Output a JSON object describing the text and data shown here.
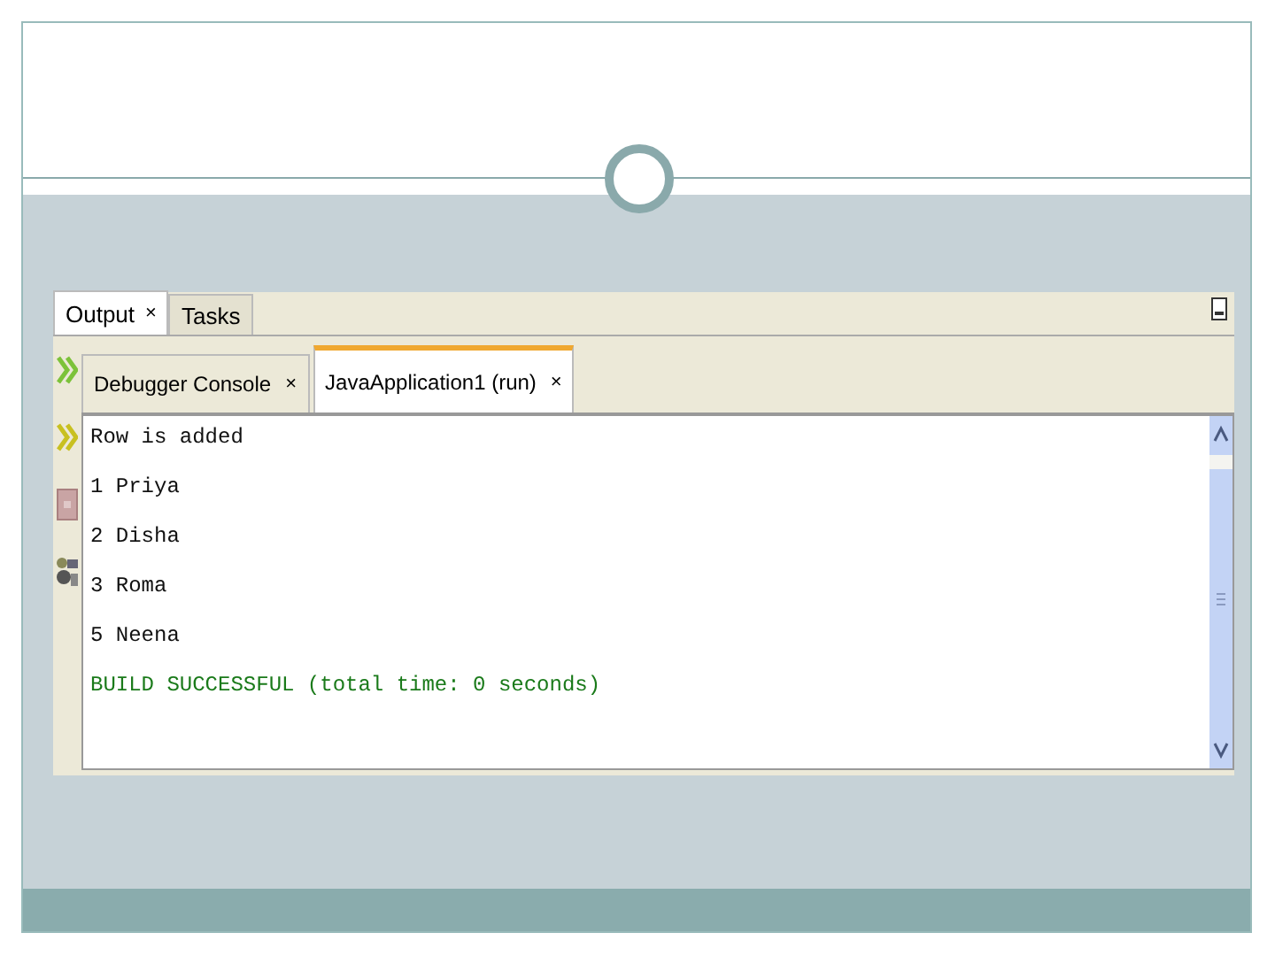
{
  "tabs": [
    {
      "label": "Output",
      "close": "×",
      "selected": true
    },
    {
      "label": "Tasks",
      "selected": false
    }
  ],
  "sub_tabs": [
    {
      "label": "Debugger Console",
      "close": "×",
      "selected": false
    },
    {
      "label": "JavaApplication1 (run)",
      "close": "×",
      "selected": true
    }
  ],
  "output_lines": [
    {
      "text": "Row is added",
      "kind": "normal"
    },
    {
      "text": "1 Priya",
      "kind": "normal"
    },
    {
      "text": "2 Disha",
      "kind": "normal"
    },
    {
      "text": "3 Roma",
      "kind": "normal"
    },
    {
      "text": "5 Neena",
      "kind": "normal"
    },
    {
      "text": "BUILD SUCCESSFUL (total time: 0 seconds)",
      "kind": "success"
    }
  ]
}
